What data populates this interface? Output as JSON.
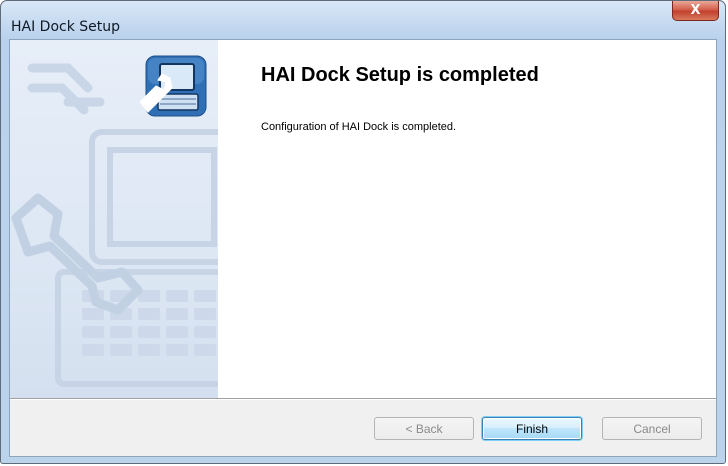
{
  "window": {
    "title": "HAI Dock Setup",
    "close_glyph": "X"
  },
  "banner": {
    "icon": "computer-wrench-icon",
    "watermark": "wrench-and-keyboard-watermark"
  },
  "content": {
    "heading": "HAI Dock Setup is completed",
    "message": "Configuration of HAI Dock is completed."
  },
  "buttons": {
    "back": "< Back",
    "finish": "Finish",
    "cancel": "Cancel"
  },
  "state": {
    "back_enabled": false,
    "finish_enabled": true,
    "cancel_enabled": false,
    "default_button": "finish"
  },
  "colors": {
    "close_button": "#c2412c",
    "banner": "#dde7f4",
    "icon_tile": "#2f6fb5",
    "default_button_border": "#3c7fb1"
  }
}
